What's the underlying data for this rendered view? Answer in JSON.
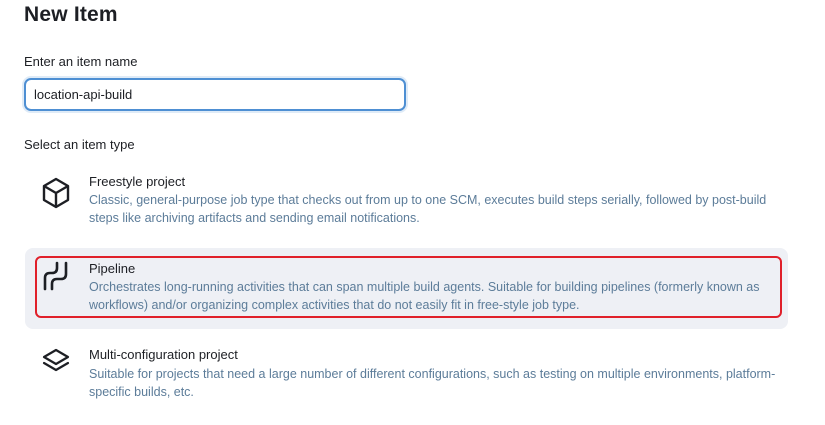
{
  "page": {
    "title": "New Item"
  },
  "name_field": {
    "label": "Enter an item name",
    "value": "location-api-build"
  },
  "item_types": {
    "label": "Select an item type",
    "items": [
      {
        "title": "Freestyle project",
        "description": "Classic, general-purpose job type that checks out from up to one SCM, executes build steps serially, followed by post-build steps like archiving artifacts and sending email notifications.",
        "icon": "cube-icon",
        "selected": false
      },
      {
        "title": "Pipeline",
        "description": "Orchestrates long-running activities that can span multiple build agents. Suitable for building pipelines (formerly known as workflows) and/or organizing complex activities that do not easily fit in free-style job type.",
        "icon": "pipeline-icon",
        "selected": true
      },
      {
        "title": "Multi-configuration project",
        "description": "Suitable for projects that need a large number of different configurations, such as testing on multiple environments, platform-specific builds, etc.",
        "icon": "layers-icon",
        "selected": false
      }
    ]
  },
  "colors": {
    "description_text": "#5c7c99",
    "selected_background": "#eef0f5",
    "input_focus_border": "#4e8fd3",
    "highlight_border": "#e0202a"
  }
}
